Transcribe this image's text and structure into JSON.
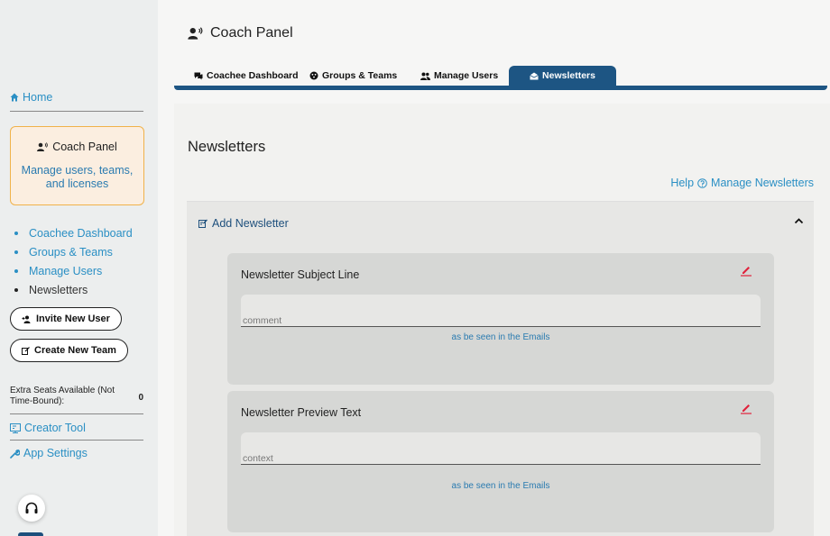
{
  "sidebar": {
    "home_label": "Home",
    "panel_card": {
      "title": "Coach Panel",
      "description": "Manage users, teams, and licenses"
    },
    "sub_nav": [
      {
        "label": "Coachee Dashboard"
      },
      {
        "label": "Groups & Teams"
      },
      {
        "label": "Manage Users"
      },
      {
        "label": "Newsletters"
      }
    ],
    "invite_button": "Invite New User",
    "create_team_button": "Create New Team",
    "seats_label": "Extra Seats Available (Not Time-Bound):",
    "seats_value": "0",
    "creator_tool": "Creator Tool",
    "app_settings": "App Settings"
  },
  "header": {
    "title": "Coach Panel"
  },
  "tabs": [
    {
      "label": "Coachee Dashboard",
      "icon": "chat-icon"
    },
    {
      "label": "Groups & Teams",
      "icon": "groups-icon"
    },
    {
      "label": "Manage Users",
      "icon": "users-icon"
    },
    {
      "label": "Newsletters",
      "icon": "newsletter-icon",
      "active": true
    }
  ],
  "content": {
    "heading": "Newsletters",
    "help_prefix": "Help",
    "help_link": "Manage Newsletters",
    "accordion_title": "Add Newsletter",
    "cards": [
      {
        "title": "Newsletter Subject Line",
        "placeholder": "comment",
        "hint": "as be seen in the Emails"
      },
      {
        "title": "Newsletter Preview Text",
        "placeholder": "context",
        "hint": "as be seen in the Emails"
      }
    ]
  },
  "colors": {
    "accent_blue": "#1d5583",
    "link_blue": "#2a8fc4",
    "card_orange_border": "#f0b24a",
    "edit_red": "#e0213b"
  }
}
